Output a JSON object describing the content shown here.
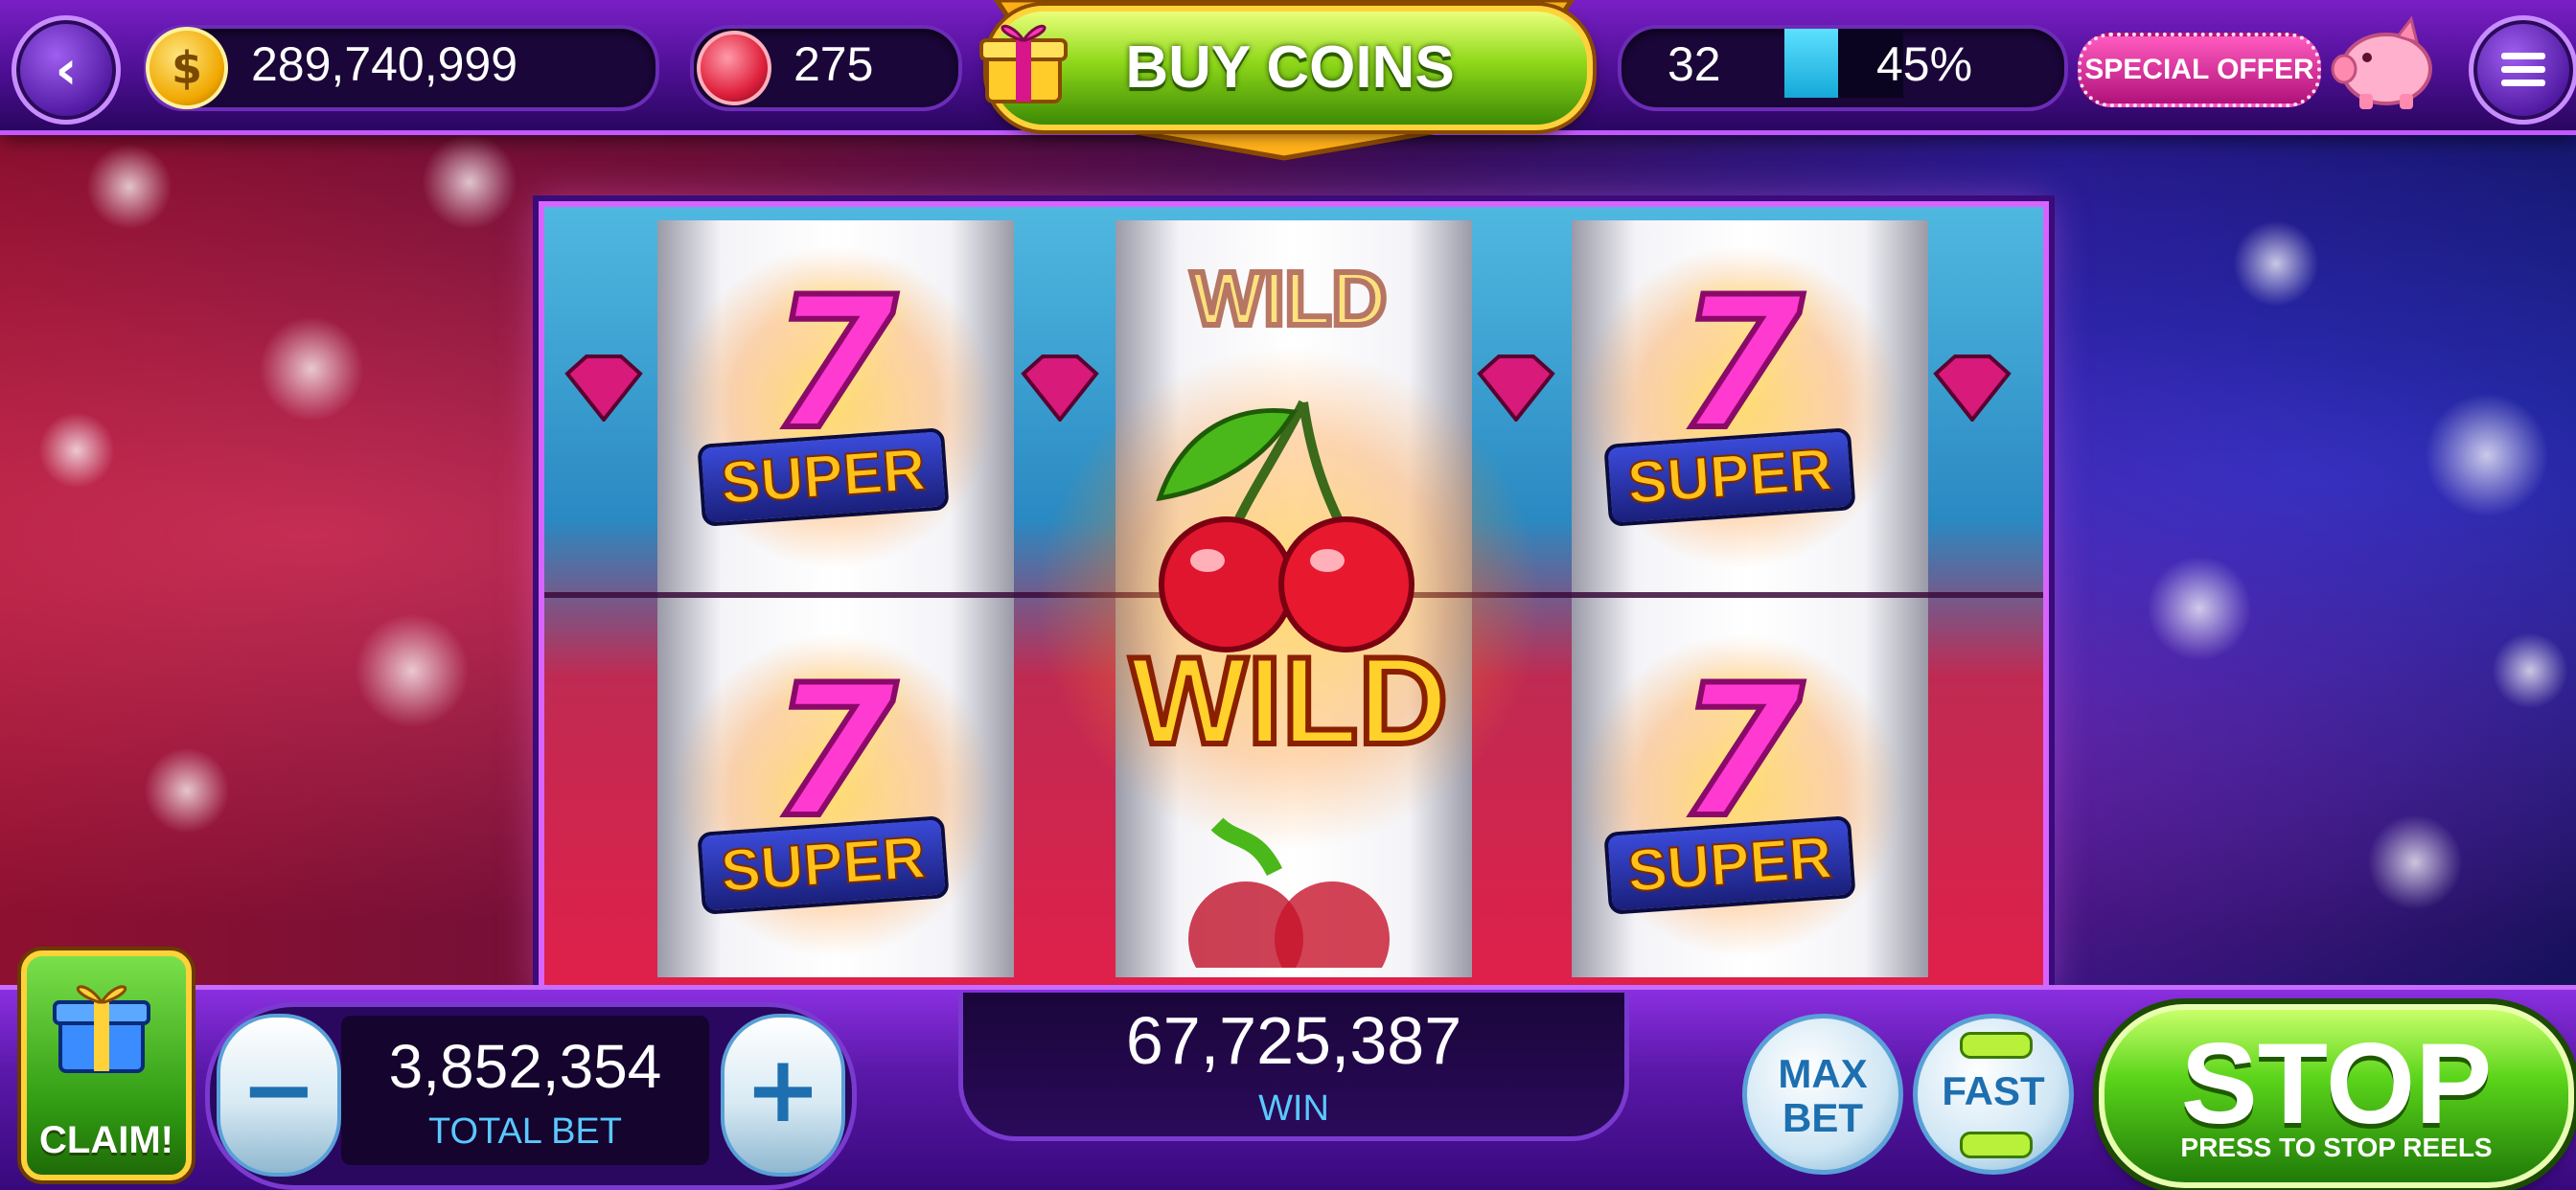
{
  "colors": {
    "topbar": "#4d0f93",
    "buy_coins_green": "#8fd81a",
    "gold": "#ffd23a",
    "xp_fill": "#15a8d8",
    "seven_pink": "#ff3ad0",
    "wild_gold": "#ffd12a"
  },
  "top_bar": {
    "back_icon": "chevron-left-icon",
    "coins": "289,740,999",
    "coin_icon": "dollar-coin-icon",
    "gems": "275",
    "gem_icon": "red-gem-icon",
    "buy_coins_label": "BUY COINS",
    "level": "32",
    "level_progress_percent": 45,
    "level_progress_label": "45%",
    "special_offer_label": "SPECIAL OFFER",
    "piggy_bank_icon": "piggy-bank-icon",
    "menu_icon": "hamburger-menu-icon"
  },
  "reels": {
    "reel_1": {
      "top": "SUPER",
      "bottom": "SUPER",
      "symbol_top": "7",
      "symbol_bottom": "7"
    },
    "reel_2": {
      "partial_top": "WILD",
      "center": "WILD",
      "symbol": "cherries"
    },
    "reel_3": {
      "top": "SUPER",
      "bottom": "SUPER",
      "symbol_top": "7",
      "symbol_bottom": "7"
    }
  },
  "bottom_bar": {
    "claim_label": "CLAIM!",
    "minus_label": "−",
    "plus_label": "+",
    "total_bet_value": "3,852,354",
    "total_bet_label": "TOTAL BET",
    "win_value": "67,725,387",
    "win_label": "WIN",
    "max_bet_line1": "MAX",
    "max_bet_line2": "BET",
    "fast_label": "FAST",
    "stop_label": "STOP",
    "stop_sublabel": "PRESS TO STOP REELS"
  }
}
